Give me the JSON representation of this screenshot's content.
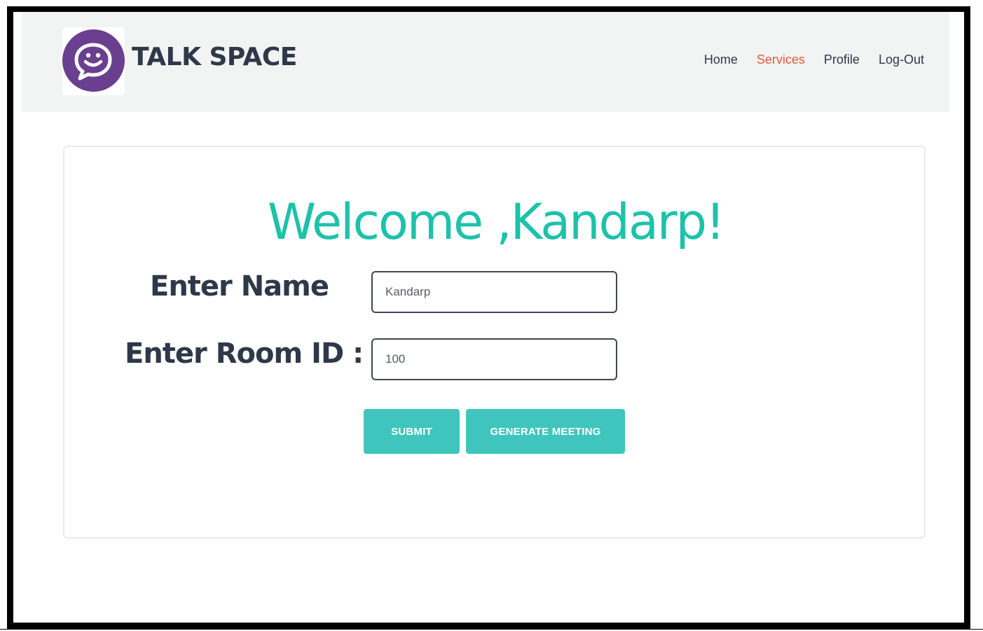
{
  "brand": {
    "name": "TALK SPACE",
    "logo_color": "#6b3f8f"
  },
  "nav": {
    "items": [
      {
        "label": "Home",
        "active": false
      },
      {
        "label": "Services",
        "active": true
      },
      {
        "label": "Profile",
        "active": false
      },
      {
        "label": "Log-Out",
        "active": false
      }
    ],
    "active_color": "#e35a3a"
  },
  "main": {
    "welcome": "Welcome ,Kandarp!",
    "name_label": "Enter Name",
    "name_value": "Kandarp",
    "room_label": "Enter Room ID :",
    "room_value": "100",
    "submit_label": "SUBMIT",
    "generate_label": "GENERATE MEETING",
    "accent_color": "#1cc2aa",
    "button_color": "#3fc5be"
  }
}
